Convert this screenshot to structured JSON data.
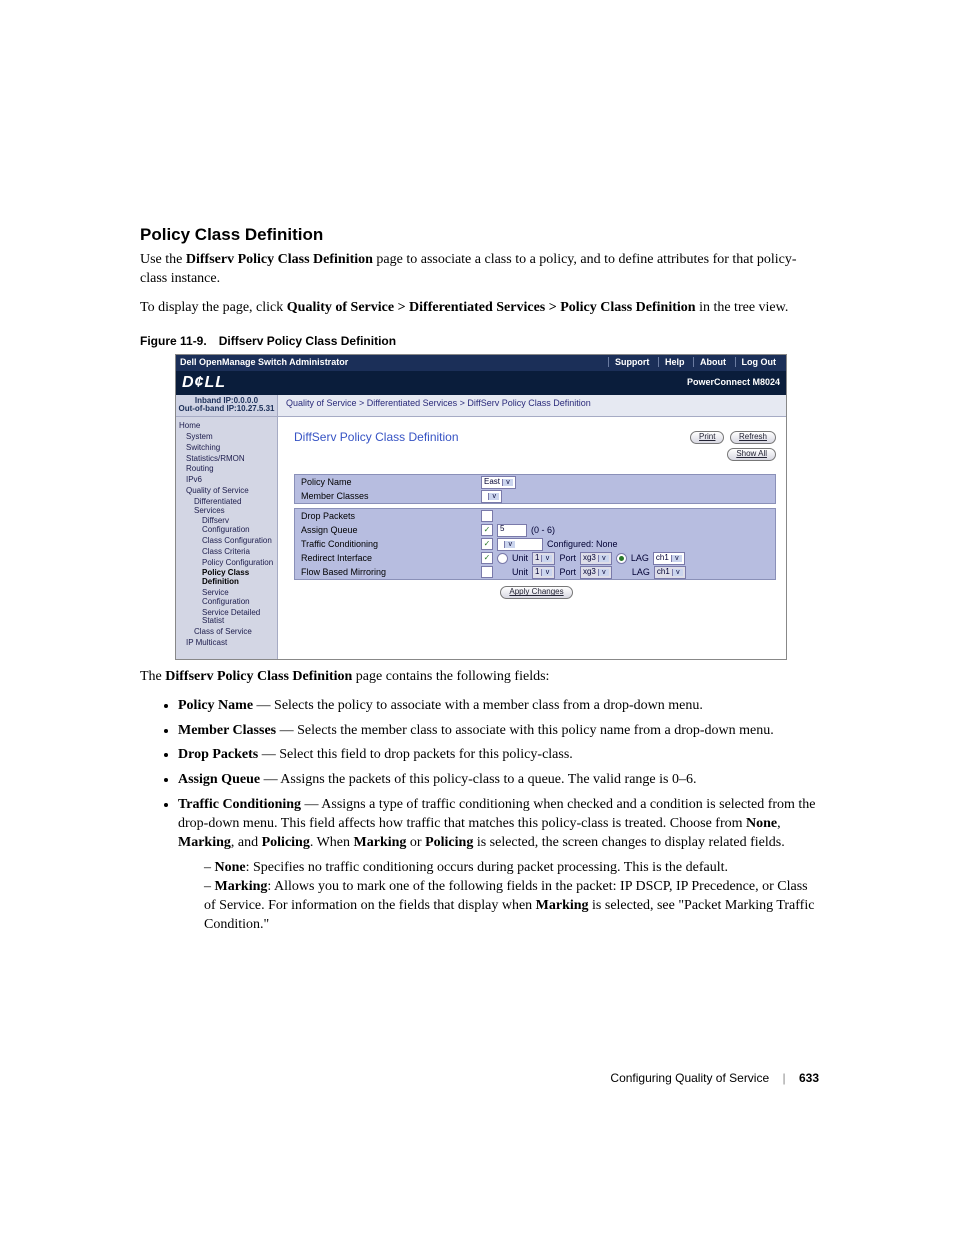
{
  "heading": "Policy Class Definition",
  "intro1_pre": "Use the ",
  "intro1_bold": "Diffserv Policy Class Definition",
  "intro1_post": " page to associate a class to a policy, and to define attributes for that policy-class instance.",
  "intro2_pre": "To display the page, click ",
  "intro2_bold": "Quality of Service > Differentiated Services > Policy Class Definition",
  "intro2_post": " in the tree view.",
  "figure": {
    "num": "Figure 11-9.",
    "title": "Diffserv Policy Class Definition"
  },
  "ss": {
    "topbar_title": "Dell OpenManage Switch Administrator",
    "nav": [
      "Support",
      "Help",
      "About",
      "Log Out"
    ],
    "logo": "D¢LL",
    "product": "PowerConnect M8024",
    "ip1": "Inband IP:0.0.0.0",
    "ip2": "Out-of-band IP:10.27.5.31",
    "breadcrumb": "Quality of Service > Differentiated Services > DiffServ Policy Class Definition",
    "tree": [
      {
        "t": "Home",
        "cls": ""
      },
      {
        "t": "System",
        "cls": "sub1"
      },
      {
        "t": "Switching",
        "cls": "sub1"
      },
      {
        "t": "Statistics/RMON",
        "cls": "sub1"
      },
      {
        "t": "Routing",
        "cls": "sub1"
      },
      {
        "t": "IPv6",
        "cls": "sub1"
      },
      {
        "t": "Quality of Service",
        "cls": "sub1"
      },
      {
        "t": "Differentiated Services",
        "cls": "sub2"
      },
      {
        "t": "Diffserv Configuration",
        "cls": "sub3"
      },
      {
        "t": "Class Configuration",
        "cls": "sub3"
      },
      {
        "t": "Class Criteria",
        "cls": "sub3"
      },
      {
        "t": "Policy Configuration",
        "cls": "sub3"
      },
      {
        "t": "Policy Class Definition",
        "cls": "sub3 active"
      },
      {
        "t": "Service Configuration",
        "cls": "sub3"
      },
      {
        "t": "Service Detailed Statist",
        "cls": "sub3"
      },
      {
        "t": "Class of Service",
        "cls": "sub2"
      },
      {
        "t": "IP Multicast",
        "cls": "sub1"
      }
    ],
    "page_title": "DiffServ Policy Class Definition",
    "btn_print": "Print",
    "btn_refresh": "Refresh",
    "btn_showall": "Show All",
    "lbl_policy_name": "Policy Name",
    "val_policy_name": "East",
    "lbl_member_classes": "Member Classes",
    "lbl_drop": "Drop Packets",
    "lbl_assign_queue": "Assign Queue",
    "val_assign_queue": "5",
    "val_assign_range": "(0 - 6)",
    "lbl_traffic_cond": "Traffic Conditioning",
    "val_traffic_cond_status": "Configured: None",
    "lbl_redirect": "Redirect Interface",
    "lbl_unit": "Unit",
    "val_unit": "1",
    "lbl_port": "Port",
    "val_port": "xg3",
    "lbl_lag": "LAG",
    "val_lag": "ch1",
    "lbl_flow_mirror": "Flow Based Mirroring",
    "btn_apply": "Apply Changes"
  },
  "after_fig_pre": "The ",
  "after_fig_bold": "Diffserv Policy Class Definition",
  "after_fig_post": " page contains the following fields:",
  "bullets": {
    "policy_name": {
      "b": "Policy Name",
      "t": " — Selects the policy to associate with a member class from a drop-down menu."
    },
    "member_classes": {
      "b": "Member Classes",
      "t": " — Selects the member class to associate with this policy name from a drop-down menu."
    },
    "drop_packets": {
      "b": "Drop Packets",
      "t": " — Select this field to drop packets for this policy-class."
    },
    "assign_queue": {
      "b": "Assign Queue",
      "t": " — Assigns the packets of this policy-class to a queue. The valid range is 0–6."
    },
    "traffic_cond": {
      "b": "Traffic Conditioning",
      "t1": " — Assigns a type of traffic conditioning when checked and a condition is selected from the drop-down menu. This field affects how traffic that matches this policy-class is treated. Choose from ",
      "b_none": "None",
      "b_marking": "Marking",
      "b_policing": "Policing",
      "t2": ". When ",
      "t3": " or ",
      "t4": " is selected, the screen changes to display related fields.",
      "sub_none": {
        "b": "None",
        "t": ": Specifies no traffic conditioning occurs during packet processing. This is the default."
      },
      "sub_marking": {
        "b": "Marking",
        "t1": ": Allows you to mark one of the following fields in the packet: IP DSCP, IP Precedence, or Class of Service. For information on the fields that display when ",
        "b2": "Marking",
        "t2": " is selected, see \"Packet Marking Traffic Condition.\""
      }
    }
  },
  "footer": {
    "chapter": "Configuring Quality of Service",
    "page": "633"
  }
}
